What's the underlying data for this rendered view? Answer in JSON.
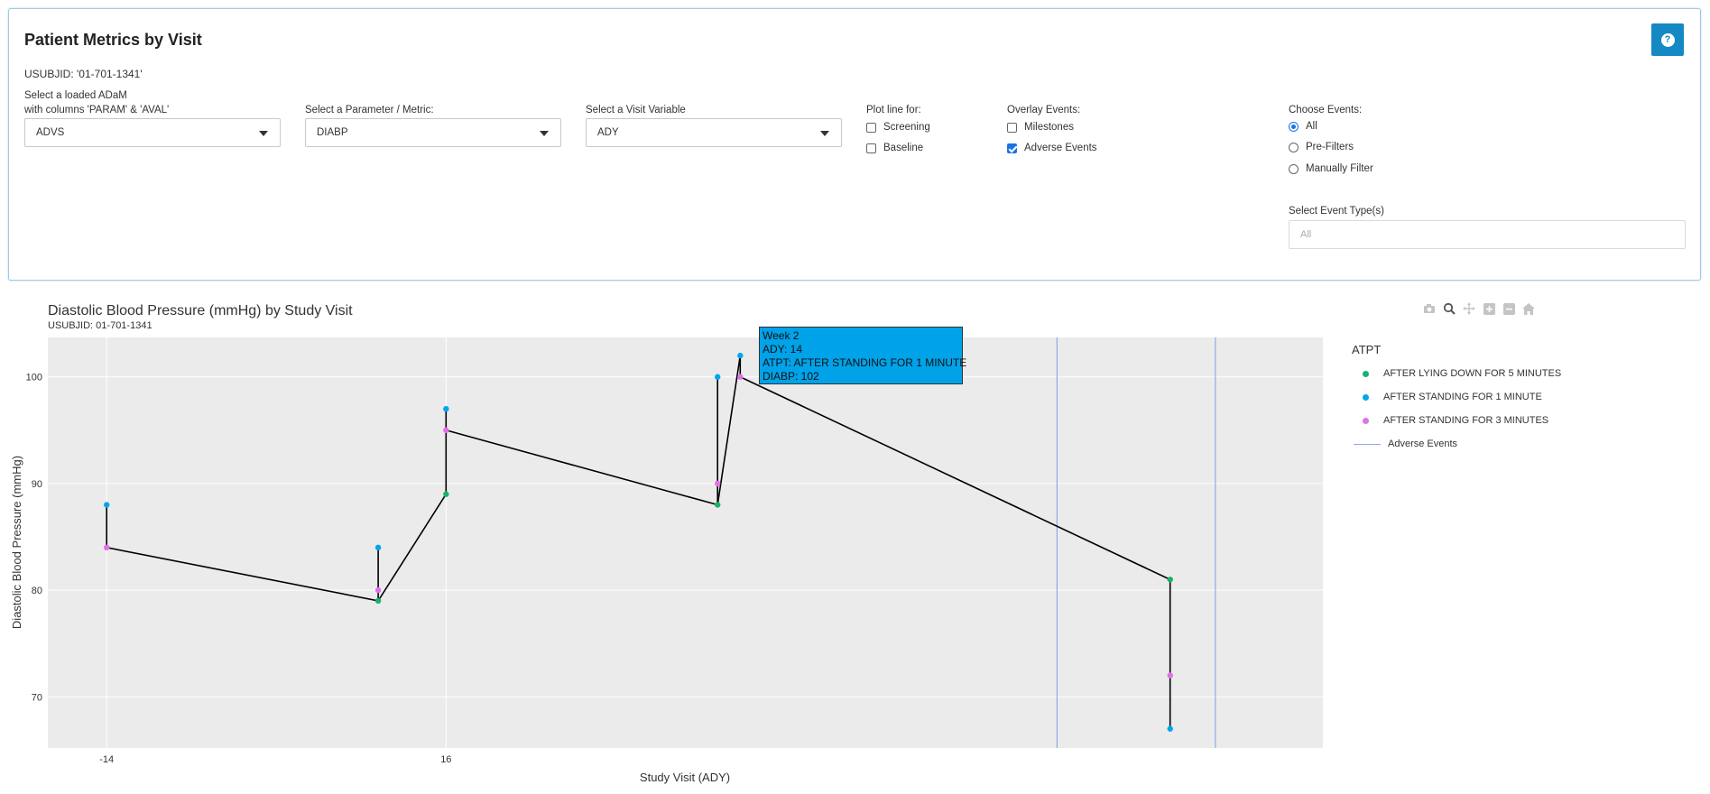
{
  "panel": {
    "title": "Patient Metrics by Visit",
    "subject": "USUBJID: '01-701-1341'",
    "help_icon": "question-circle-icon"
  },
  "controls": {
    "dataset": {
      "label_line1": "Select a loaded ADaM",
      "label_line2": "with columns 'PARAM' & 'AVAL'",
      "value": "ADVS"
    },
    "parameter": {
      "label": "Select a Parameter / Metric:",
      "value": "DIABP"
    },
    "visit_var": {
      "label": "Select a Visit Variable",
      "value": "ADY"
    },
    "plot_line": {
      "label": "Plot line for:",
      "options": [
        {
          "label": "Screening",
          "checked": false
        },
        {
          "label": "Baseline",
          "checked": false
        }
      ]
    },
    "overlay": {
      "label": "Overlay Events:",
      "options": [
        {
          "label": "Milestones",
          "checked": false
        },
        {
          "label": "Adverse Events",
          "checked": true
        }
      ]
    },
    "choose_events": {
      "label": "Choose Events:",
      "options": [
        {
          "label": "All",
          "selected": true
        },
        {
          "label": "Pre-Filters",
          "selected": false
        },
        {
          "label": "Manually Filter",
          "selected": false
        }
      ]
    },
    "event_types": {
      "label": "Select Event Type(s)",
      "placeholder": "All"
    }
  },
  "modebar": [
    "camera-icon",
    "zoom-icon",
    "pan-icon",
    "zoom-in-icon",
    "zoom-out-icon",
    "home-icon"
  ],
  "chart_data": {
    "type": "scatter",
    "title": "Diastolic Blood Pressure (mmHg) by Study Visit",
    "subtitle": "USUBJID: 01-701-1341",
    "xlabel": "Study Visit (ADY)",
    "ylabel": "Diastolic Blood Pressure (mmHg)",
    "xlim": [
      -19.2,
      93.5
    ],
    "ylim": [
      65.2,
      103.7
    ],
    "x_ticks": [
      -14,
      16
    ],
    "y_ticks": [
      70,
      80,
      90,
      100
    ],
    "grid": true,
    "legend_title": "ATPT",
    "legend_position": "right",
    "series": [
      {
        "name": "AFTER LYING DOWN FOR 5 MINUTES",
        "color": "#19b16d",
        "points": [
          [
            10,
            79
          ],
          [
            16,
            89
          ],
          [
            40,
            88
          ],
          [
            80,
            81
          ]
        ]
      },
      {
        "name": "AFTER STANDING FOR 1 MINUTE",
        "color": "#00a6ed",
        "points": [
          [
            -14,
            88
          ],
          [
            10,
            84
          ],
          [
            16,
            97
          ],
          [
            40,
            100
          ],
          [
            42,
            102
          ],
          [
            80,
            67
          ]
        ]
      },
      {
        "name": "AFTER STANDING FOR 3 MINUTES",
        "color": "#e070ec",
        "points": [
          [
            -14,
            84
          ],
          [
            10,
            80
          ],
          [
            16,
            95
          ],
          [
            40,
            90
          ],
          [
            42,
            100
          ],
          [
            80,
            72
          ]
        ]
      }
    ],
    "line": {
      "color": "#000000",
      "points": [
        [
          -14,
          88
        ],
        [
          -14,
          84
        ],
        [
          10,
          79
        ],
        [
          10,
          84
        ],
        [
          10,
          79
        ],
        [
          16,
          89
        ],
        [
          16,
          97
        ],
        [
          16,
          95
        ],
        [
          40,
          88
        ],
        [
          40,
          100
        ],
        [
          40,
          88
        ],
        [
          42,
          102
        ],
        [
          42,
          100
        ],
        [
          80,
          81
        ],
        [
          80,
          67
        ]
      ]
    },
    "adverse_events": {
      "name": "Adverse Events",
      "color": "#93a8e8",
      "x": [
        70,
        84
      ]
    },
    "tooltip": {
      "lines": [
        "Week 2",
        "ADY: 14",
        "ATPT: AFTER STANDING FOR 1 MINUTE",
        "DIABP: 102"
      ]
    }
  }
}
